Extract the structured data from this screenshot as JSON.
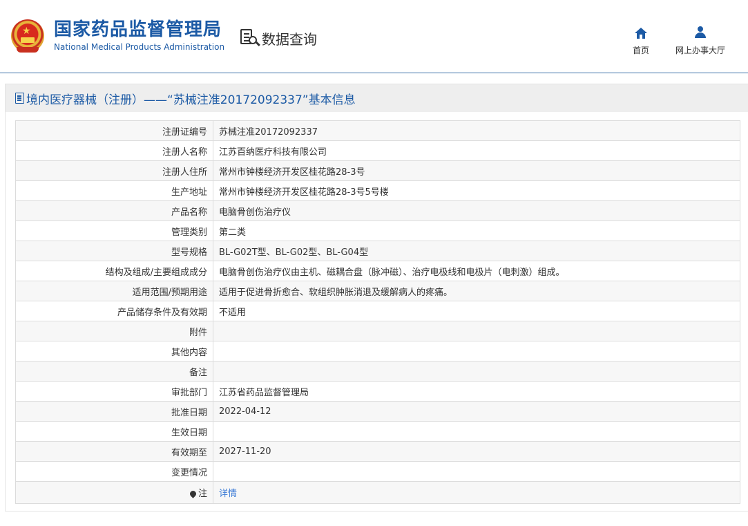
{
  "header": {
    "org_cn": "国家药品监督管理局",
    "org_en": "National Medical Products Administration",
    "query_label": "数据查询",
    "nav": [
      {
        "label": "首页",
        "icon": "home-icon"
      },
      {
        "label": "网上办事大厅",
        "icon": "user-icon"
      }
    ]
  },
  "panel": {
    "title": "境内医疗器械（注册）——“苏械注准20172092337”基本信息"
  },
  "rows": [
    {
      "label": "注册证编号",
      "value": "苏械注准20172092337"
    },
    {
      "label": "注册人名称",
      "value": "江苏百纳医疗科技有限公司"
    },
    {
      "label": "注册人住所",
      "value": "常州市钟楼经济开发区桂花路28-3号"
    },
    {
      "label": "生产地址",
      "value": "常州市钟楼经济开发区桂花路28-3号5号楼"
    },
    {
      "label": "产品名称",
      "value": "电脑骨创伤治疗仪"
    },
    {
      "label": "管理类别",
      "value": "第二类"
    },
    {
      "label": "型号规格",
      "value": "BL-G02T型、BL-G02型、BL-G04型"
    },
    {
      "label": "结构及组成/主要组成成分",
      "value": "电脑骨创伤治疗仪由主机、磁耦合盘（脉冲磁）、治疗电极线和电极片（电刺激）组成。"
    },
    {
      "label": "适用范围/预期用途",
      "value": "适用于促进骨折愈合、软组织肿胀消退及缓解病人的疼痛。"
    },
    {
      "label": "产品储存条件及有效期",
      "value": "不适用"
    },
    {
      "label": "附件",
      "value": ""
    },
    {
      "label": "其他内容",
      "value": ""
    },
    {
      "label": "备注",
      "value": ""
    },
    {
      "label": "审批部门",
      "value": "江苏省药品监督管理局"
    },
    {
      "label": "批准日期",
      "value": "2022-04-12"
    },
    {
      "label": "生效日期",
      "value": ""
    },
    {
      "label": "有效期至",
      "value": "2027-11-20"
    },
    {
      "label": "变更情况",
      "value": ""
    }
  ],
  "note_row": {
    "label": "注",
    "link": "详情"
  }
}
